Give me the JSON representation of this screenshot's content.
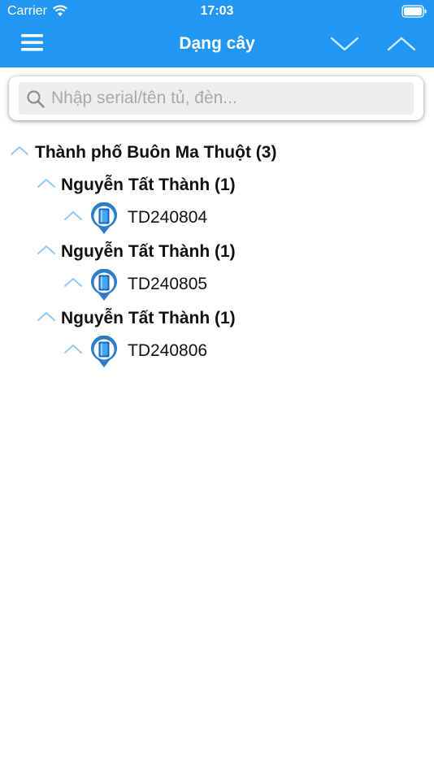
{
  "status_bar": {
    "carrier": "Carrier",
    "time": "17:03"
  },
  "nav": {
    "title": "Dạng cây"
  },
  "search": {
    "placeholder": "Nhập serial/tên tủ, đèn..."
  },
  "tree": {
    "root": {
      "label": "Thành phố Buôn Ma Thuột (3)"
    },
    "groups": [
      {
        "label": "Nguyễn Tất Thành (1)",
        "device": "TD240804"
      },
      {
        "label": "Nguyễn Tất Thành (1)",
        "device": "TD240805"
      },
      {
        "label": "Nguyễn Tất Thành (1)",
        "device": "TD240806"
      }
    ]
  },
  "colors": {
    "primary": "#2196F3",
    "chevron": "#90CAF9",
    "pin": "#2C7CC9"
  }
}
